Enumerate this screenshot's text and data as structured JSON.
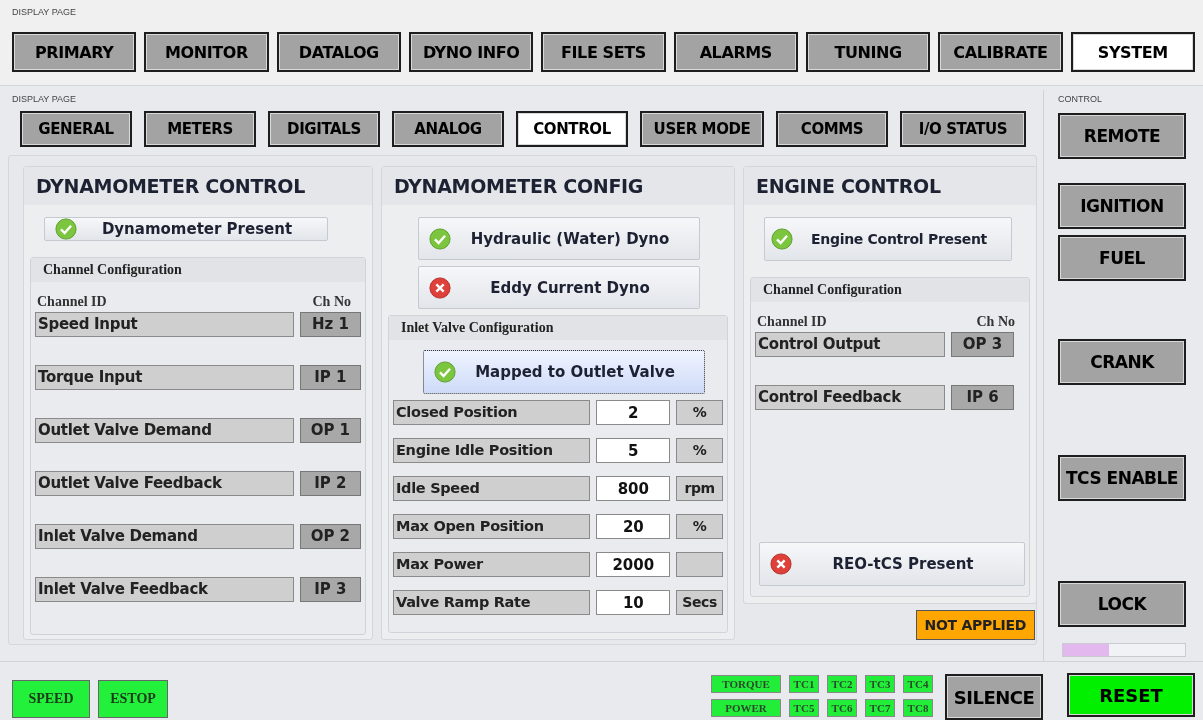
{
  "display_label": "DISPLAY PAGE",
  "main_tabs": [
    {
      "label": "PRIMARY",
      "selected": false
    },
    {
      "label": "MONITOR",
      "selected": false
    },
    {
      "label": "DATALOG",
      "selected": false
    },
    {
      "label": "DYNO INFO",
      "selected": false
    },
    {
      "label": "FILE SETS",
      "selected": false
    },
    {
      "label": "ALARMS",
      "selected": false
    },
    {
      "label": "TUNING",
      "selected": false
    },
    {
      "label": "CALIBRATE",
      "selected": false
    },
    {
      "label": "SYSTEM",
      "selected": true
    }
  ],
  "sub_label": "DISPLAY PAGE",
  "sub_tabs": [
    {
      "label": "GENERAL",
      "selected": false
    },
    {
      "label": "METERS",
      "selected": false
    },
    {
      "label": "DIGITALS",
      "selected": false
    },
    {
      "label": "ANALOG",
      "selected": false
    },
    {
      "label": "CONTROL",
      "selected": true
    },
    {
      "label": "USER MODE",
      "selected": false
    },
    {
      "label": "COMMS",
      "selected": false
    },
    {
      "label": "I/O STATUS",
      "selected": false
    }
  ],
  "dyno_control": {
    "title": "DYNAMOMETER CONTROL",
    "toggles": [
      {
        "label": "Dynamometer Present",
        "checked": true,
        "focused": false
      }
    ],
    "group": {
      "title": "Channel Configuration",
      "col_id": "Channel ID",
      "col_no": "Ch No",
      "rows": [
        {
          "label": "Speed Input",
          "channel": "Hz 1"
        },
        {
          "label": "Torque Input",
          "channel": "IP 1"
        },
        {
          "label": "Outlet Valve Demand",
          "channel": "OP 1"
        },
        {
          "label": "Outlet Valve Feedback",
          "channel": "IP 2"
        },
        {
          "label": "Inlet Valve Demand",
          "channel": "OP 2"
        },
        {
          "label": "Inlet Valve Feedback",
          "channel": "IP 3"
        }
      ]
    }
  },
  "dyno_config": {
    "title": "DYNAMOMETER CONFIG",
    "toggles": [
      {
        "label": "Hydraulic (Water) Dyno",
        "checked": true,
        "focused": false
      },
      {
        "label": "Eddy Current Dyno",
        "checked": false,
        "focused": false
      }
    ],
    "group": {
      "title": "Inlet Valve Configuration",
      "toggle": {
        "label": "Mapped to Outlet Valve",
        "checked": true,
        "focused": true
      },
      "rows": [
        {
          "label": "Closed Position",
          "value": "2",
          "unit": "%"
        },
        {
          "label": "Engine Idle Position",
          "value": "5",
          "unit": "%"
        },
        {
          "label": "Idle Speed",
          "value": "800",
          "unit": "rpm"
        },
        {
          "label": "Max Open Position",
          "value": "20",
          "unit": "%"
        },
        {
          "label": "Max Power",
          "value": "2000"
        },
        {
          "label": "Valve Ramp Rate",
          "value": "10",
          "unit": "Secs"
        }
      ]
    }
  },
  "engine_control": {
    "title": "ENGINE CONTROL",
    "toggles": [
      {
        "label": "Engine Control Present",
        "checked": true,
        "focused": false
      }
    ],
    "group": {
      "title": "Channel Configuration",
      "col_id": "Channel ID",
      "col_no": "Ch No",
      "rows": [
        {
          "label": "Control Output",
          "channel": "OP 3"
        },
        {
          "label": "Control Feedback",
          "channel": "IP 6"
        }
      ]
    },
    "tcs_toggle": {
      "label": "REO-tCS Present",
      "checked": false,
      "focused": false
    },
    "status": "NOT APPLIED"
  },
  "control_label": "CONTROL",
  "control_buttons": [
    {
      "label": "REMOTE",
      "on": false
    },
    {
      "label": "IGNITION",
      "on": false
    },
    {
      "label": "FUEL",
      "on": false
    },
    {
      "label": "CRANK",
      "on": false
    },
    {
      "label": "TCS ENABLE",
      "on": false
    },
    {
      "label": "LOCK",
      "on": false
    }
  ],
  "progress": {
    "level": 0.38
  },
  "reset": {
    "label": "RESET",
    "on": true
  },
  "status_buttons": [
    {
      "label": "SPEED",
      "on": true
    },
    {
      "label": "ESTOP",
      "on": true
    }
  ],
  "indicator_rows": [
    {
      "items": [
        {
          "label": "TORQUE",
          "on": true
        },
        {
          "label": "TC1",
          "on": true
        },
        {
          "label": "TC2",
          "on": true
        },
        {
          "label": "TC3",
          "on": true
        },
        {
          "label": "TC4",
          "on": true
        }
      ]
    },
    {
      "items": [
        {
          "label": "POWER",
          "on": true
        },
        {
          "label": "TC5",
          "on": true
        },
        {
          "label": "TC6",
          "on": true
        },
        {
          "label": "TC7",
          "on": true
        },
        {
          "label": "TC8",
          "on": true
        }
      ]
    }
  ],
  "silence": {
    "label": "SILENCE",
    "on": false
  }
}
